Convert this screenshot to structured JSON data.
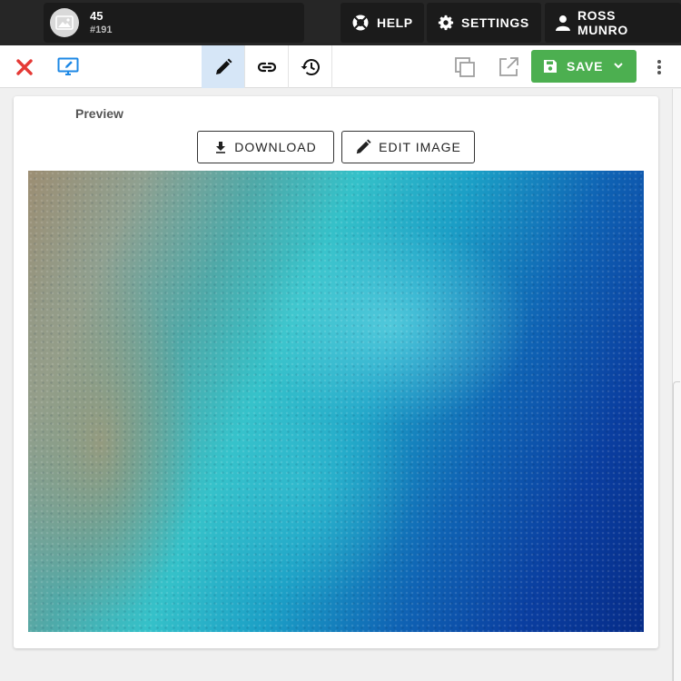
{
  "header": {
    "record": {
      "title": "45",
      "id": "#191",
      "thumb_icon": "image-icon"
    },
    "help_label": "HELP",
    "settings_label": "SETTINGS",
    "user_name": "ROSS MUNRO"
  },
  "toolbar": {
    "close_icon": "close-icon",
    "preview_icon": "monitor-edit-icon",
    "tabs": [
      {
        "name": "edit",
        "icon": "pencil-icon",
        "active": true
      },
      {
        "name": "links",
        "icon": "link-icon",
        "active": false
      },
      {
        "name": "history",
        "icon": "history-icon",
        "active": false
      }
    ],
    "save_label": "SAVE",
    "colors": {
      "save": "#4caf50",
      "close": "#e53935",
      "preview": "#1e88e5",
      "active_tab": "#d6e6f7"
    }
  },
  "card": {
    "label": "Preview",
    "download_label": "DOWNLOAD",
    "edit_image_label": "EDIT IMAGE"
  }
}
